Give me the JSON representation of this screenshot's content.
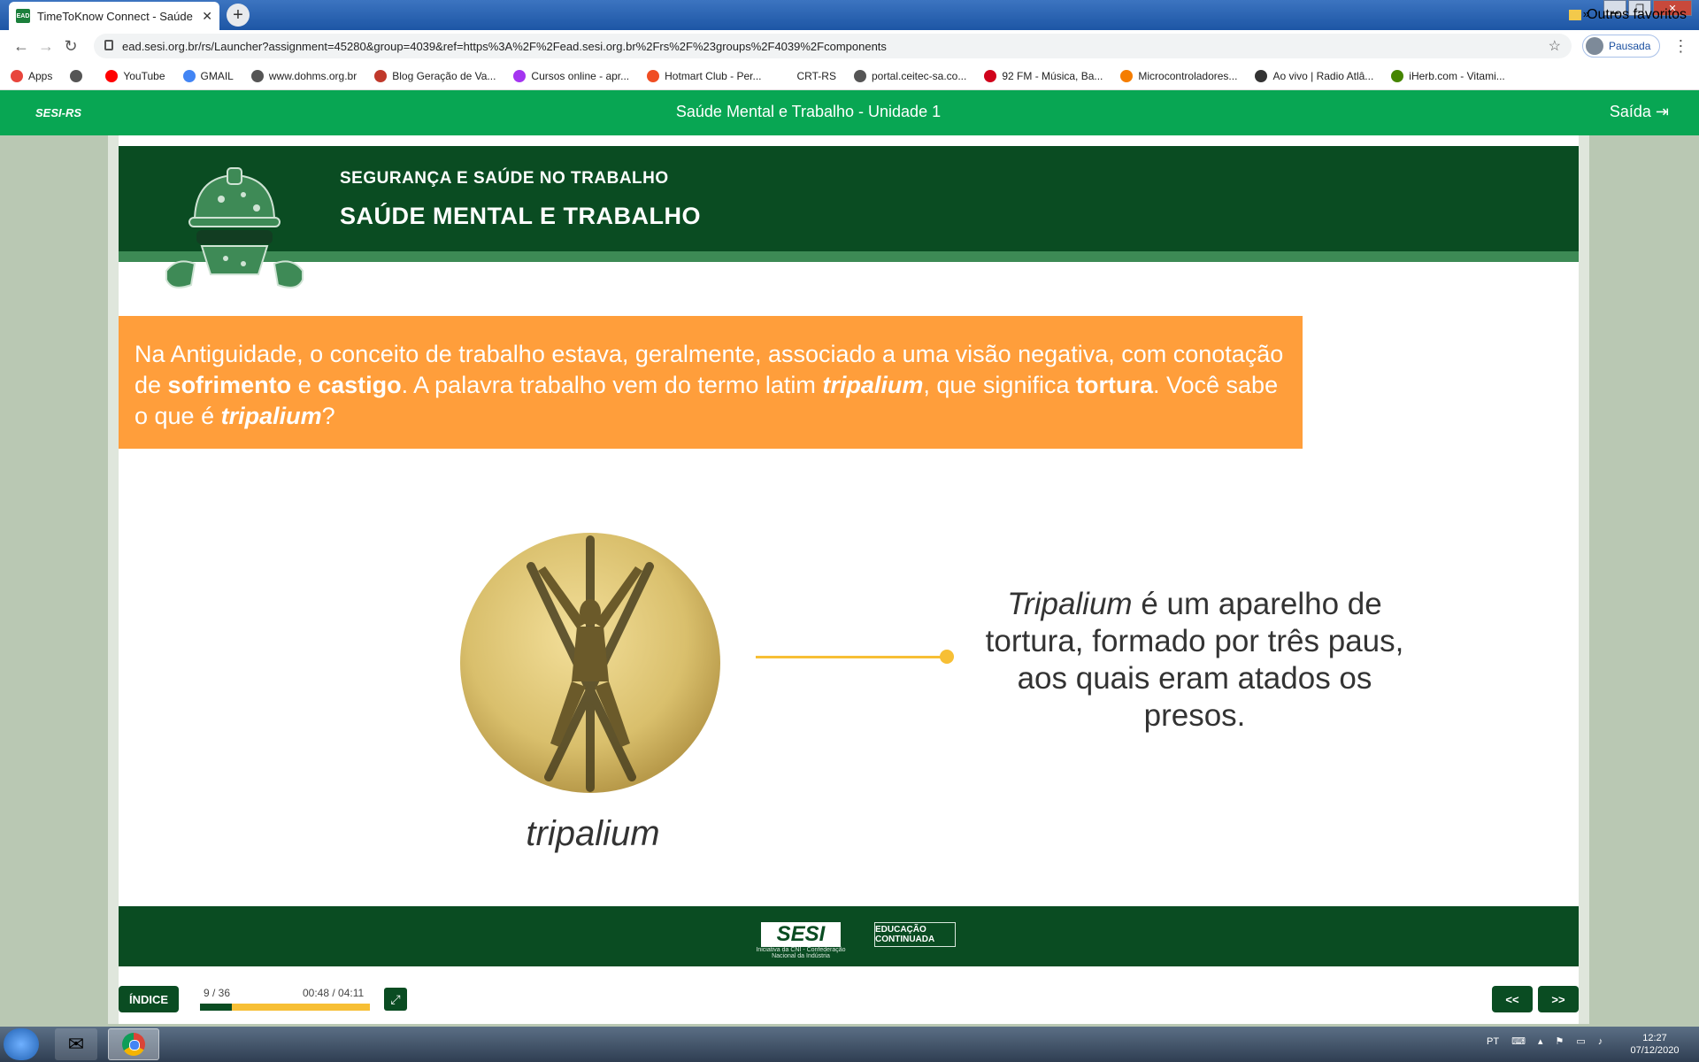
{
  "browser": {
    "tab_title": "TimeToKnow Connect - Saúde M",
    "tab_favicon": "EAD",
    "url": "ead.sesi.org.br/rs/Launcher?assignment=45280&group=4039&ref=https%3A%2F%2Fead.sesi.org.br%2Frs%2F%23groups%2F4039%2Fcomponents",
    "profile_label": "Pausada",
    "bookmarks": [
      {
        "label": "Apps",
        "icon": "apps-grid-icon",
        "color": "#e8453c"
      },
      {
        "label": "",
        "icon": "globe-icon",
        "color": "#555555"
      },
      {
        "label": "YouTube",
        "icon": "youtube-icon",
        "color": "#ff0000"
      },
      {
        "label": "GMAIL",
        "icon": "google-icon",
        "color": "#4285f4"
      },
      {
        "label": "www.dohms.org.br",
        "icon": "globe-icon",
        "color": "#555555"
      },
      {
        "label": "Blog Geração de Va...",
        "icon": "club-icon",
        "color": "#c0392b"
      },
      {
        "label": "Cursos online - apr...",
        "icon": "udemy-icon",
        "color": "#a435f0"
      },
      {
        "label": "Hotmart Club - Per...",
        "icon": "flame-icon",
        "color": "#f04e23"
      },
      {
        "label": "CRT-RS",
        "icon": "blank-icon",
        "color": "#ffffff"
      },
      {
        "label": "portal.ceitec-sa.co...",
        "icon": "globe-icon",
        "color": "#555555"
      },
      {
        "label": "92 FM - Música, Ba...",
        "icon": "radio-92-icon",
        "color": "#d0021b"
      },
      {
        "label": "Microcontroladores...",
        "icon": "blogger-icon",
        "color": "#f57d00"
      },
      {
        "label": "Ao vivo | Radio Atlâ...",
        "icon": "radio-icon",
        "color": "#333333"
      },
      {
        "label": "iHerb.com - Vitami...",
        "icon": "leaf-icon",
        "color": "#458500"
      }
    ],
    "bookmarks_more": "»",
    "other_bookmarks": "Outros favoritos"
  },
  "app": {
    "brand": "SESI-RS",
    "title": "Saúde Mental e Trabalho - Unidade 1",
    "exit_label": "Saída"
  },
  "lesson": {
    "supertitle": "SEGURANÇA E SAÚDE NO TRABALHO",
    "title": "SAÚDE MENTAL E TRABALHO",
    "intro_parts": [
      {
        "t": "Na Antiguidade, o conceito de trabalho estava, geralmente, associado a uma visão negativa, com conotação de ",
        "s": ""
      },
      {
        "t": "sofrimento",
        "s": "b"
      },
      {
        "t": " e ",
        "s": ""
      },
      {
        "t": "castigo",
        "s": "b"
      },
      {
        "t": ". A palavra trabalho vem do termo latim ",
        "s": ""
      },
      {
        "t": "tripalium",
        "s": "bi"
      },
      {
        "t": ", que significa ",
        "s": ""
      },
      {
        "t": "tortura",
        "s": "b"
      },
      {
        "t": ". Você sabe o que é ",
        "s": ""
      },
      {
        "t": "tripalium",
        "s": "bi"
      },
      {
        "t": "?",
        "s": ""
      }
    ],
    "image_caption": "tripalium",
    "description_italic": "Tripalium",
    "description_rest": " é um aparelho de tortura, formado por três paus, aos quais eram atados os presos."
  },
  "footer": {
    "sesi_logo": "SESI",
    "sesi_subtitle": "Iniciativa da CNI - Confederação Nacional da Indústria",
    "edu_logo": "EDUCAÇÃO CONTINUADA"
  },
  "controls": {
    "index_label": "ÍNDICE",
    "page_count": "9 / 36",
    "time": "00:48 / 04:11",
    "progress": 0.19,
    "prev_label": "<<",
    "next_label": ">>"
  },
  "taskbar": {
    "language": "PT",
    "time": "12:27",
    "date": "07/12/2020"
  },
  "colors": {
    "green_bar": "#08a653",
    "dark_green": "#0a4c22",
    "orange": "#ff9e3b",
    "accent_yellow": "#f7bf35"
  }
}
